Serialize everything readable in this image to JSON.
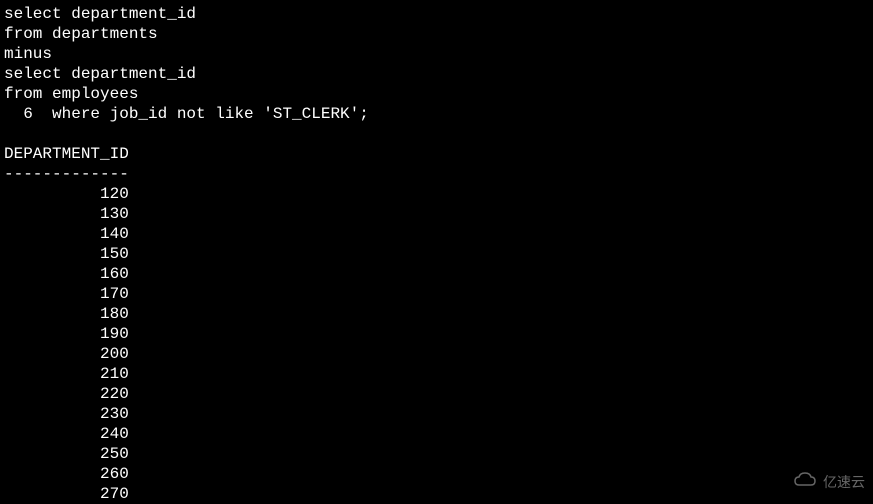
{
  "query": {
    "lines": [
      "select department_id",
      "from departments",
      "minus",
      "select department_id",
      "from employees",
      "  6  where job_id not like 'ST_CLERK';"
    ]
  },
  "result": {
    "column_header": "DEPARTMENT_ID",
    "separator": "-------------",
    "values": [
      "          120",
      "          130",
      "          140",
      "          150",
      "          160",
      "          170",
      "          180",
      "          190",
      "          200",
      "          210",
      "          220",
      "          230",
      "          240",
      "          250",
      "          260",
      "          270"
    ]
  },
  "watermark": {
    "text": "亿速云"
  }
}
